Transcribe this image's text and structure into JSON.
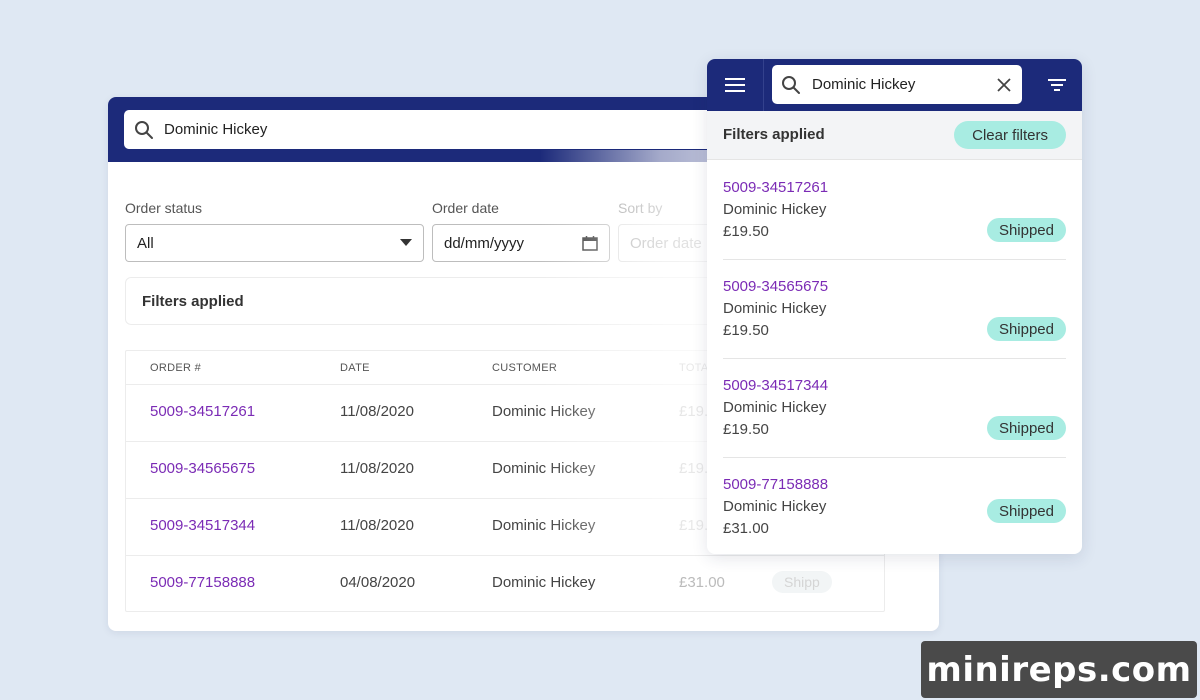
{
  "desktop": {
    "search": {
      "value": "Dominic Hickey",
      "icon": "search-icon"
    },
    "filters": {
      "order_status": {
        "label": "Order status",
        "value": "All"
      },
      "order_date": {
        "label": "Order date",
        "value": "dd/mm/yyyy"
      },
      "sort_by": {
        "label": "Sort by",
        "value": "Order date"
      }
    },
    "filters_applied_label": "Filters applied",
    "table": {
      "headers": [
        "ORDER #",
        "DATE",
        "CUSTOMER",
        "TOTA"
      ],
      "rows": [
        {
          "order": "5009-34517261",
          "date": "11/08/2020",
          "customer": "Dominic Hickey",
          "total": "£19.",
          "status": ""
        },
        {
          "order": "5009-34565675",
          "date": "11/08/2020",
          "customer": "Dominic Hickey",
          "total": "£19.",
          "status": ""
        },
        {
          "order": "5009-34517344",
          "date": "11/08/2020",
          "customer": "Dominic Hickey",
          "total": "£19.",
          "status": ""
        },
        {
          "order": "5009-77158888",
          "date": "04/08/2020",
          "customer": "Dominic Hickey",
          "total": "£31.00",
          "status": "Shipp"
        }
      ]
    }
  },
  "mobile": {
    "search": {
      "value": "Dominic Hickey"
    },
    "filters_applied_label": "Filters applied",
    "clear_filters_label": "Clear filters",
    "cards": [
      {
        "order": "5009-34517261",
        "customer": "Dominic Hickey",
        "total": "£19.50",
        "status": "Shipped"
      },
      {
        "order": "5009-34565675",
        "customer": "Dominic Hickey",
        "total": "£19.50",
        "status": "Shipped"
      },
      {
        "order": "5009-34517344",
        "customer": "Dominic Hickey",
        "total": "£19.50",
        "status": "Shipped"
      },
      {
        "order": "5009-77158888",
        "customer": "Dominic Hickey",
        "total": "£31.00",
        "status": "Shipped"
      }
    ]
  },
  "watermark": "minireps.com",
  "colors": {
    "header_navy": "#1c2a7a",
    "background": "#dfe8f3",
    "link_purple": "#7b2bb5",
    "badge_mint": "#a8ece2"
  }
}
